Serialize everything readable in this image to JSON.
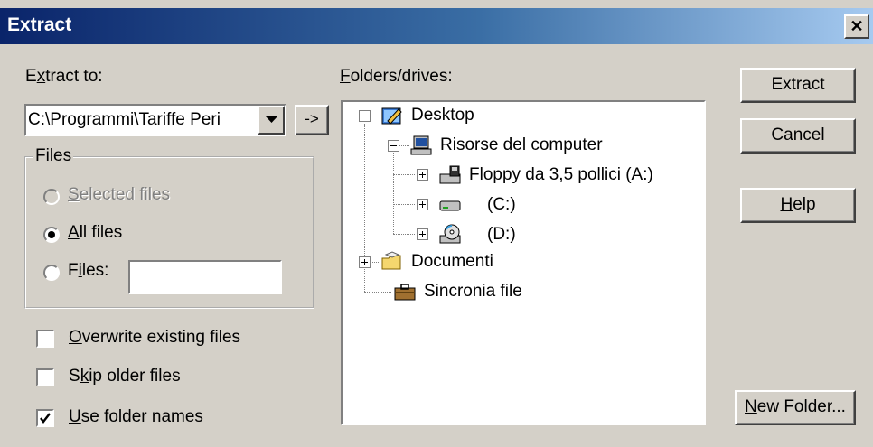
{
  "window": {
    "title": "Extract",
    "close_glyph": "✕"
  },
  "extract_to": {
    "label_pre": "E",
    "label_ul": "x",
    "label_post": "tract to:",
    "combo_value": "C:\\Programmi\\Tariffe Peri",
    "browse_label": "->"
  },
  "files_group": {
    "legend": "Files",
    "selected_files_ul": "S",
    "selected_files_rest": "elected files",
    "all_files_ul": "A",
    "all_files_rest": "ll files",
    "files_pre": "F",
    "files_ul": "i",
    "files_rest": "les:",
    "files_value": "",
    "selected_choice": "all_files"
  },
  "options": {
    "overwrite_ul": "O",
    "overwrite_rest": "verwrite existing files",
    "overwrite_checked": false,
    "skip_pre": "S",
    "skip_ul": "k",
    "skip_rest": "ip older files",
    "skip_checked": false,
    "use_folder_ul": "U",
    "use_folder_rest": "se folder names",
    "use_folder_checked": true
  },
  "folders": {
    "label_ul": "F",
    "label_rest": "olders/drives:",
    "tree": [
      {
        "label": "Desktop",
        "icon": "desktop-icon",
        "expander": "minus"
      },
      {
        "label": "Risorse del computer",
        "icon": "my-computer-icon",
        "expander": "minus"
      },
      {
        "label": "Floppy da 3,5 pollici (A:)",
        "icon": "floppy-drive-icon",
        "expander": "plus"
      },
      {
        "label": "(C:)",
        "icon": "hard-drive-icon",
        "expander": "plus"
      },
      {
        "label": "(D:)",
        "icon": "cd-drive-icon",
        "expander": "plus"
      },
      {
        "label": "Documenti",
        "icon": "documents-folder-icon",
        "expander": "plus"
      },
      {
        "label": "Sincronia file",
        "icon": "briefcase-icon",
        "expander": "none"
      }
    ]
  },
  "buttons": {
    "extract": "Extract",
    "cancel": "Cancel",
    "help_ul": "H",
    "help_rest": "elp",
    "new_folder_ul": "N",
    "new_folder_rest": "ew Folder..."
  },
  "colors": {
    "face": "#d4d0c8",
    "title_start": "#0a246a",
    "title_end": "#a6caf0",
    "disabled_text": "#808080"
  }
}
